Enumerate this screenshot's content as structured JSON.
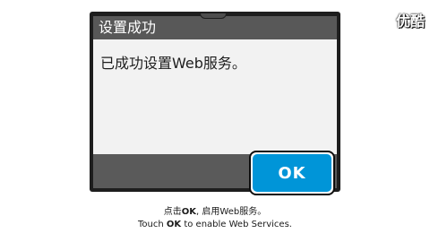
{
  "dialog": {
    "title": "设置成功",
    "message": "已成功设置Web服务。"
  },
  "ok_button": {
    "label": "OK",
    "color": "#0095d8"
  },
  "caption": {
    "zh_pre": "点击",
    "zh_ok": "OK",
    "zh_post": ", 启用Web服务。",
    "en_pre": "Touch ",
    "en_ok": "OK",
    "en_post": " to enable Web Services."
  },
  "watermark": {
    "text": "优酷"
  }
}
